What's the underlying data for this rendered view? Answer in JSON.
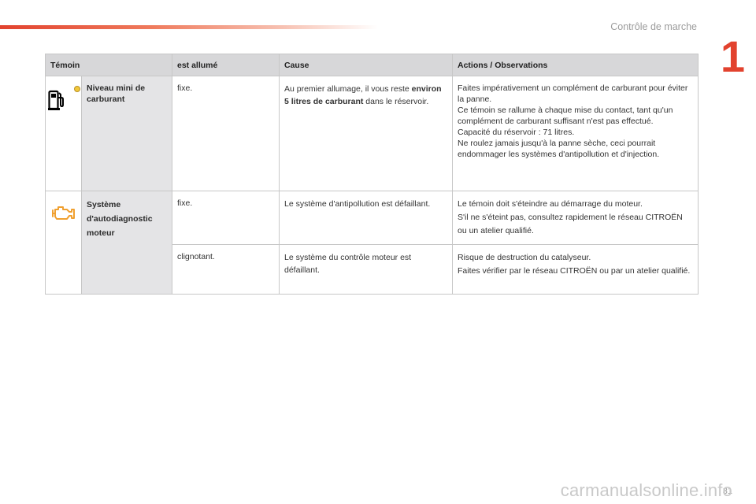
{
  "header": {
    "chapter_title": "Contrôle de marche",
    "chapter_number": "1"
  },
  "table": {
    "columns": [
      "Témoin",
      "est allumé",
      "Cause",
      "Actions / Observations"
    ],
    "fuel": {
      "icon": "fuel-pump-icon",
      "name": "Niveau mini de carburant",
      "state": "fixe.",
      "cause_pre": "Au premier allumage, il vous reste ",
      "cause_bold": "environ 5 litres de carburant",
      "cause_post": " dans le réservoir.",
      "actions": "Faites impérativement un complément de carburant pour éviter la panne.\nCe témoin se rallume à chaque mise du contact, tant qu'un complément de carburant suffisant n'est pas effectué.\nCapacité du réservoir : 71 litres.\nNe roulez jamais jusqu'à la panne sèche, ceci pourrait endommager les systèmes d'antipollution et d'injection."
    },
    "diag": {
      "icon": "engine-icon",
      "name": "Système d'autodiagnostic moteur",
      "rows": [
        {
          "state": "fixe.",
          "cause": "Le système d'antipollution est défaillant.",
          "actions": "Le témoin doit s'éteindre au démarrage du moteur.\nS'il ne s'éteint pas, consultez rapidement le réseau CITROËN ou un atelier qualifié."
        },
        {
          "state": "clignotant.",
          "cause": "Le système du contrôle moteur est défaillant.",
          "actions": "Risque de destruction du catalyseur.\nFaites vérifier par le réseau CITROËN ou par un atelier qualifié."
        }
      ]
    }
  },
  "footer": {
    "page_number": "31",
    "watermark": "carmanualsonline.info"
  },
  "colors": {
    "accent": "#e2422e",
    "warning_amber": "#f0a030",
    "header_bg": "#d7d7d9",
    "name_bg": "#e4e4e6"
  }
}
